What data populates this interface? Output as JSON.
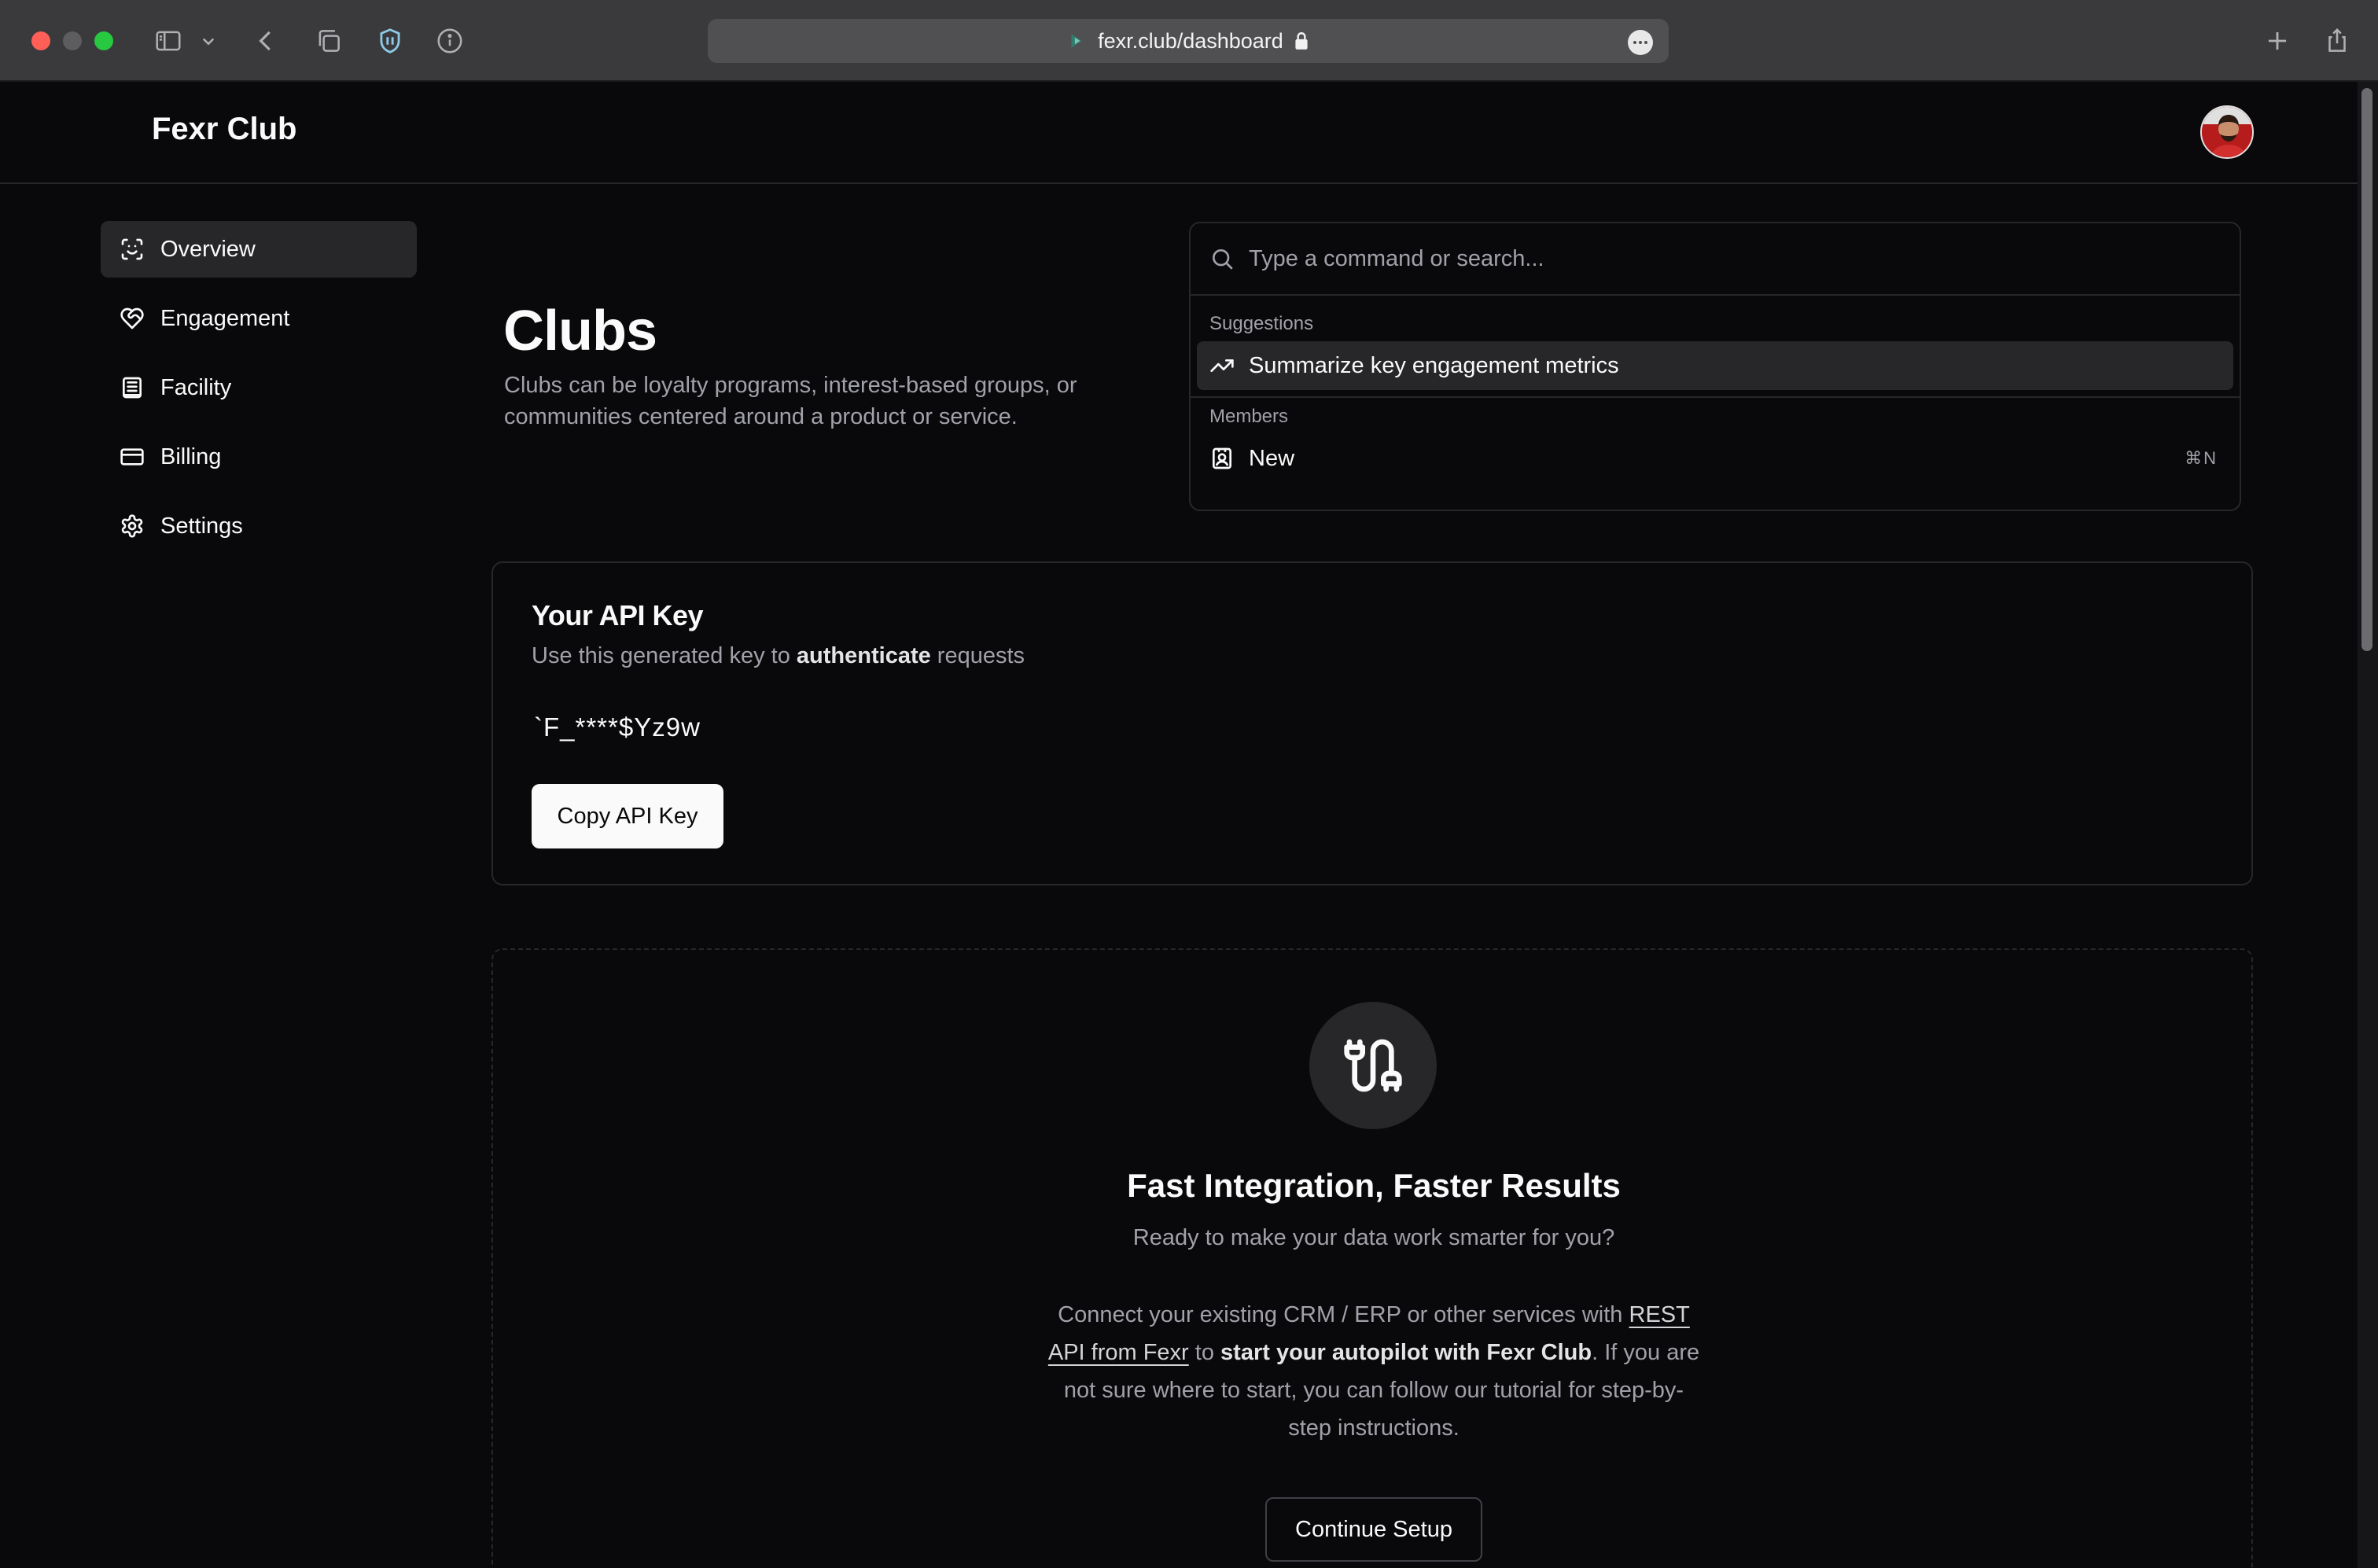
{
  "browser": {
    "url": "fexr.club/dashboard"
  },
  "header": {
    "brand": "Fexr Club"
  },
  "sidebar": {
    "items": [
      {
        "label": "Overview",
        "icon": "scan-face-icon",
        "active": true
      },
      {
        "label": "Engagement",
        "icon": "heart-handshake-icon",
        "active": false
      },
      {
        "label": "Facility",
        "icon": "building-icon",
        "active": false
      },
      {
        "label": "Billing",
        "icon": "credit-card-icon",
        "active": false
      },
      {
        "label": "Settings",
        "icon": "gear-icon",
        "active": false
      }
    ]
  },
  "main": {
    "title": "Clubs",
    "description": "Clubs can be loyalty programs, interest-based groups, or communities centered around a product or service."
  },
  "command": {
    "placeholder": "Type a command or search...",
    "groups": [
      {
        "label": "Suggestions",
        "items": [
          {
            "label": "Summarize key engagement metrics",
            "icon": "trending-up-icon"
          }
        ]
      },
      {
        "label": "Members",
        "items": [
          {
            "label": "New",
            "icon": "contact-icon",
            "shortcut": "⌘N"
          }
        ]
      }
    ]
  },
  "api_card": {
    "title": "Your API Key",
    "subtitle_before": "Use this generated key to ",
    "subtitle_bold": "authenticate",
    "subtitle_after": " requests",
    "key": "`F_****$Yz9w",
    "copy_label": "Copy API Key"
  },
  "integration": {
    "title": "Fast Integration, Faster Results",
    "subtitle": "Ready to make your data work smarter for you?",
    "body_1": "Connect your existing CRM / ERP or other services with ",
    "body_link": "REST API from Fexr",
    "body_2": " to ",
    "body_bold": "start your autopilot with Fexr Club",
    "body_3": ". If you are not sure where to start, you can follow our tutorial for step-by-step instructions.",
    "button_label": "Continue Setup"
  },
  "colors": {
    "background": "#09090b",
    "border": "#27272a",
    "muted_text": "#a1a1aa",
    "foreground": "#fafafa"
  }
}
